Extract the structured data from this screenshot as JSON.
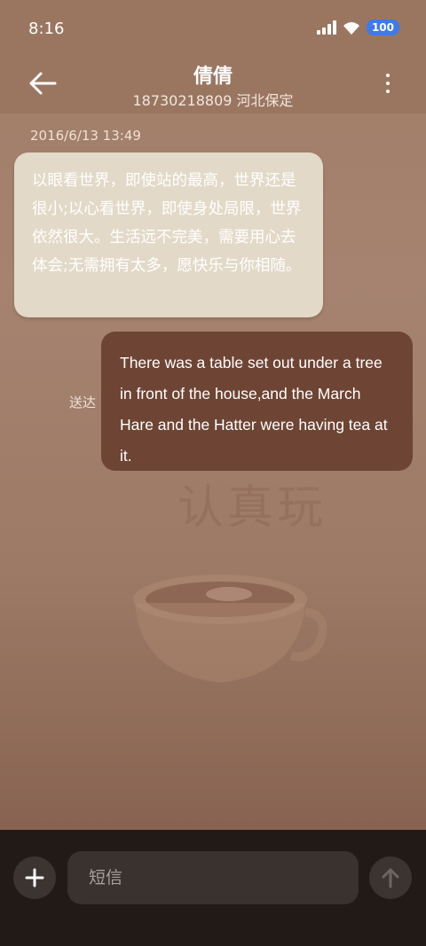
{
  "status_bar": {
    "time": "8:16",
    "battery": "100"
  },
  "header": {
    "contact_name": "倩倩",
    "contact_detail": "18730218809 河北保定"
  },
  "conversation": {
    "timestamp": "2016/6/13 13:49",
    "incoming_message": "以眼看世界，即使站的最高，世界还是很小;以心看世界，即使身处局限，世界依然很大。生活远不完美，需要用心去体会;无需拥有太多，愿快乐与你相随。",
    "outgoing_message": "There was a table set out under a tree in front of the house,and the March Hare and the Hatter were having tea at it.",
    "delivery_status": "送达"
  },
  "background": {
    "decor_text": "认真玩"
  },
  "composer": {
    "placeholder": "短信"
  },
  "colors": {
    "incoming_bubble": "#e3d9c8",
    "outgoing_bubble": "#6e4434",
    "bottom_bar": "#221a17"
  }
}
